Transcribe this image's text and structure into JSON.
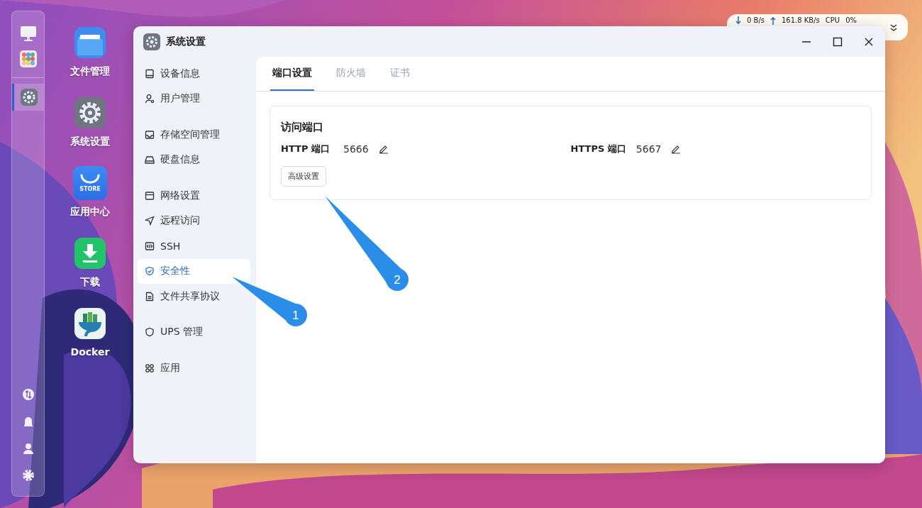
{
  "status_widget": {
    "down_rate": "0 B/s",
    "up_rate": "161.8 KB/s",
    "cpu_label": "CPU",
    "cpu_value": "0%"
  },
  "dock": {
    "open_apps": [
      {
        "selected": true
      }
    ]
  },
  "desktop_icons": [
    {
      "label": "文件管理"
    },
    {
      "label": "系统设置"
    },
    {
      "label": "应用中心",
      "badge_text": "STORE"
    },
    {
      "label": "下载"
    },
    {
      "label": "Docker"
    }
  ],
  "window": {
    "title": "系统设置",
    "sidebar": {
      "groups": [
        {
          "items": [
            {
              "label": "设备信息",
              "selected": false
            },
            {
              "label": "用户管理",
              "selected": false
            }
          ]
        },
        {
          "items": [
            {
              "label": "存储空间管理",
              "selected": false
            },
            {
              "label": "硬盘信息",
              "selected": false
            }
          ]
        },
        {
          "items": [
            {
              "label": "网络设置",
              "selected": false
            },
            {
              "label": "远程访问",
              "selected": false
            },
            {
              "label": "SSH",
              "selected": false
            },
            {
              "label": "安全性",
              "selected": true
            },
            {
              "label": "文件共享协议",
              "selected": false
            }
          ]
        },
        {
          "items": [
            {
              "label": "UPS 管理",
              "selected": false
            }
          ]
        },
        {
          "items": [
            {
              "label": "应用",
              "selected": false
            }
          ]
        }
      ]
    },
    "tabs": [
      {
        "label": "端口设置",
        "selected": true
      },
      {
        "label": "防火墙",
        "selected": false
      },
      {
        "label": "证书",
        "selected": false
      }
    ],
    "card": {
      "title": "访问端口",
      "ports": [
        {
          "label": "HTTP 端口",
          "value": "5666"
        },
        {
          "label": "HTTPS 端口",
          "value": "5667"
        }
      ],
      "button": "高级设置"
    }
  },
  "callouts": [
    {
      "label": "1"
    },
    {
      "label": "2"
    }
  ]
}
